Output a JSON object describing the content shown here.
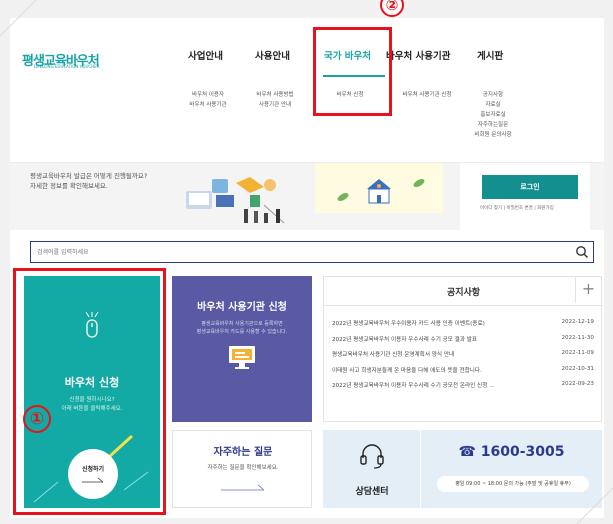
{
  "logo": {
    "text": "평생교육바우처",
    "sub": "LIFELONG EDUCATION VOUCHER"
  },
  "nav": {
    "items": [
      {
        "label": "사업안내",
        "subs": [
          "바우처 이용자",
          "바우처 사용기관"
        ]
      },
      {
        "label": "사용안내",
        "subs": [
          "바우처 사용방법",
          "사용기관 안내"
        ]
      },
      {
        "label": "국가 바우처",
        "subs": [
          "바우처 신청"
        ]
      },
      {
        "label": "바우처 사용기관",
        "subs": [
          "바우처 사용기관 신청"
        ]
      },
      {
        "label": "게시판",
        "subs": [
          "공지사항",
          "자료실",
          "홍보자료실",
          "자주하는질문",
          "비회원 문의사항"
        ]
      }
    ]
  },
  "markers": {
    "one": "①",
    "two": "②"
  },
  "banner": {
    "text_line1": "평생교육바우처 발급은 어떻게 진행될까요?",
    "text_line2": "자세한 정보를 확인해보세요.",
    "login": "로그인",
    "login_links": "아이디 찾기 | 비밀번호 변경 | 회원가입"
  },
  "search": {
    "placeholder": "검색어를 입력하세요"
  },
  "voucher_card": {
    "title": "바우처 신청",
    "desc_line1": "신청을 원하시나요?",
    "desc_line2": "아래 버튼을 클릭해주세요.",
    "button": "신청하기"
  },
  "org_card": {
    "title": "바우처 사용기관 신청",
    "desc_line1": "평생교육바우처 사용기관으로 등록하면",
    "desc_line2": "평생교육바우처 카드를 사용할 수 있습니다."
  },
  "faq_card": {
    "title": "자주하는 질문",
    "desc": "자주하는 질문을 확인해보세요."
  },
  "notice": {
    "title": "공지사항",
    "plus": "+",
    "items": [
      {
        "title": "2022년 평생교육바우처 우수이용자 카드 사용 인증 이벤트(종료)",
        "date": "2022-12-19"
      },
      {
        "title": "2022년 평생교육바우처 이용자 우수사례 수기 공모 결과 발표",
        "date": "2022-11-30"
      },
      {
        "title": "평생교육바우처 사용기관 신청 운영계획서 양식 안내",
        "date": "2022-11-09"
      },
      {
        "title": "이태원 사고 희생자분들께 온 마음을 다해 애도의 뜻을 전합니다.",
        "date": "2022-10-31"
      },
      {
        "title": "2022년 평생교육바우처 이용자 우수사례 수기 공모전 온라인 신청 …",
        "date": "2022-09-23"
      }
    ]
  },
  "contact": {
    "label": "상담센터",
    "phone": "☎ 1600-3005",
    "hours": "평일 09:00 ~ 18:00 문의 가능 (주말 및 공휴일 휴무)"
  },
  "colors": {
    "teal": "#13a9a4",
    "purple": "#5a5aa4",
    "navy": "#2d3a8c",
    "red": "#e8121d"
  }
}
